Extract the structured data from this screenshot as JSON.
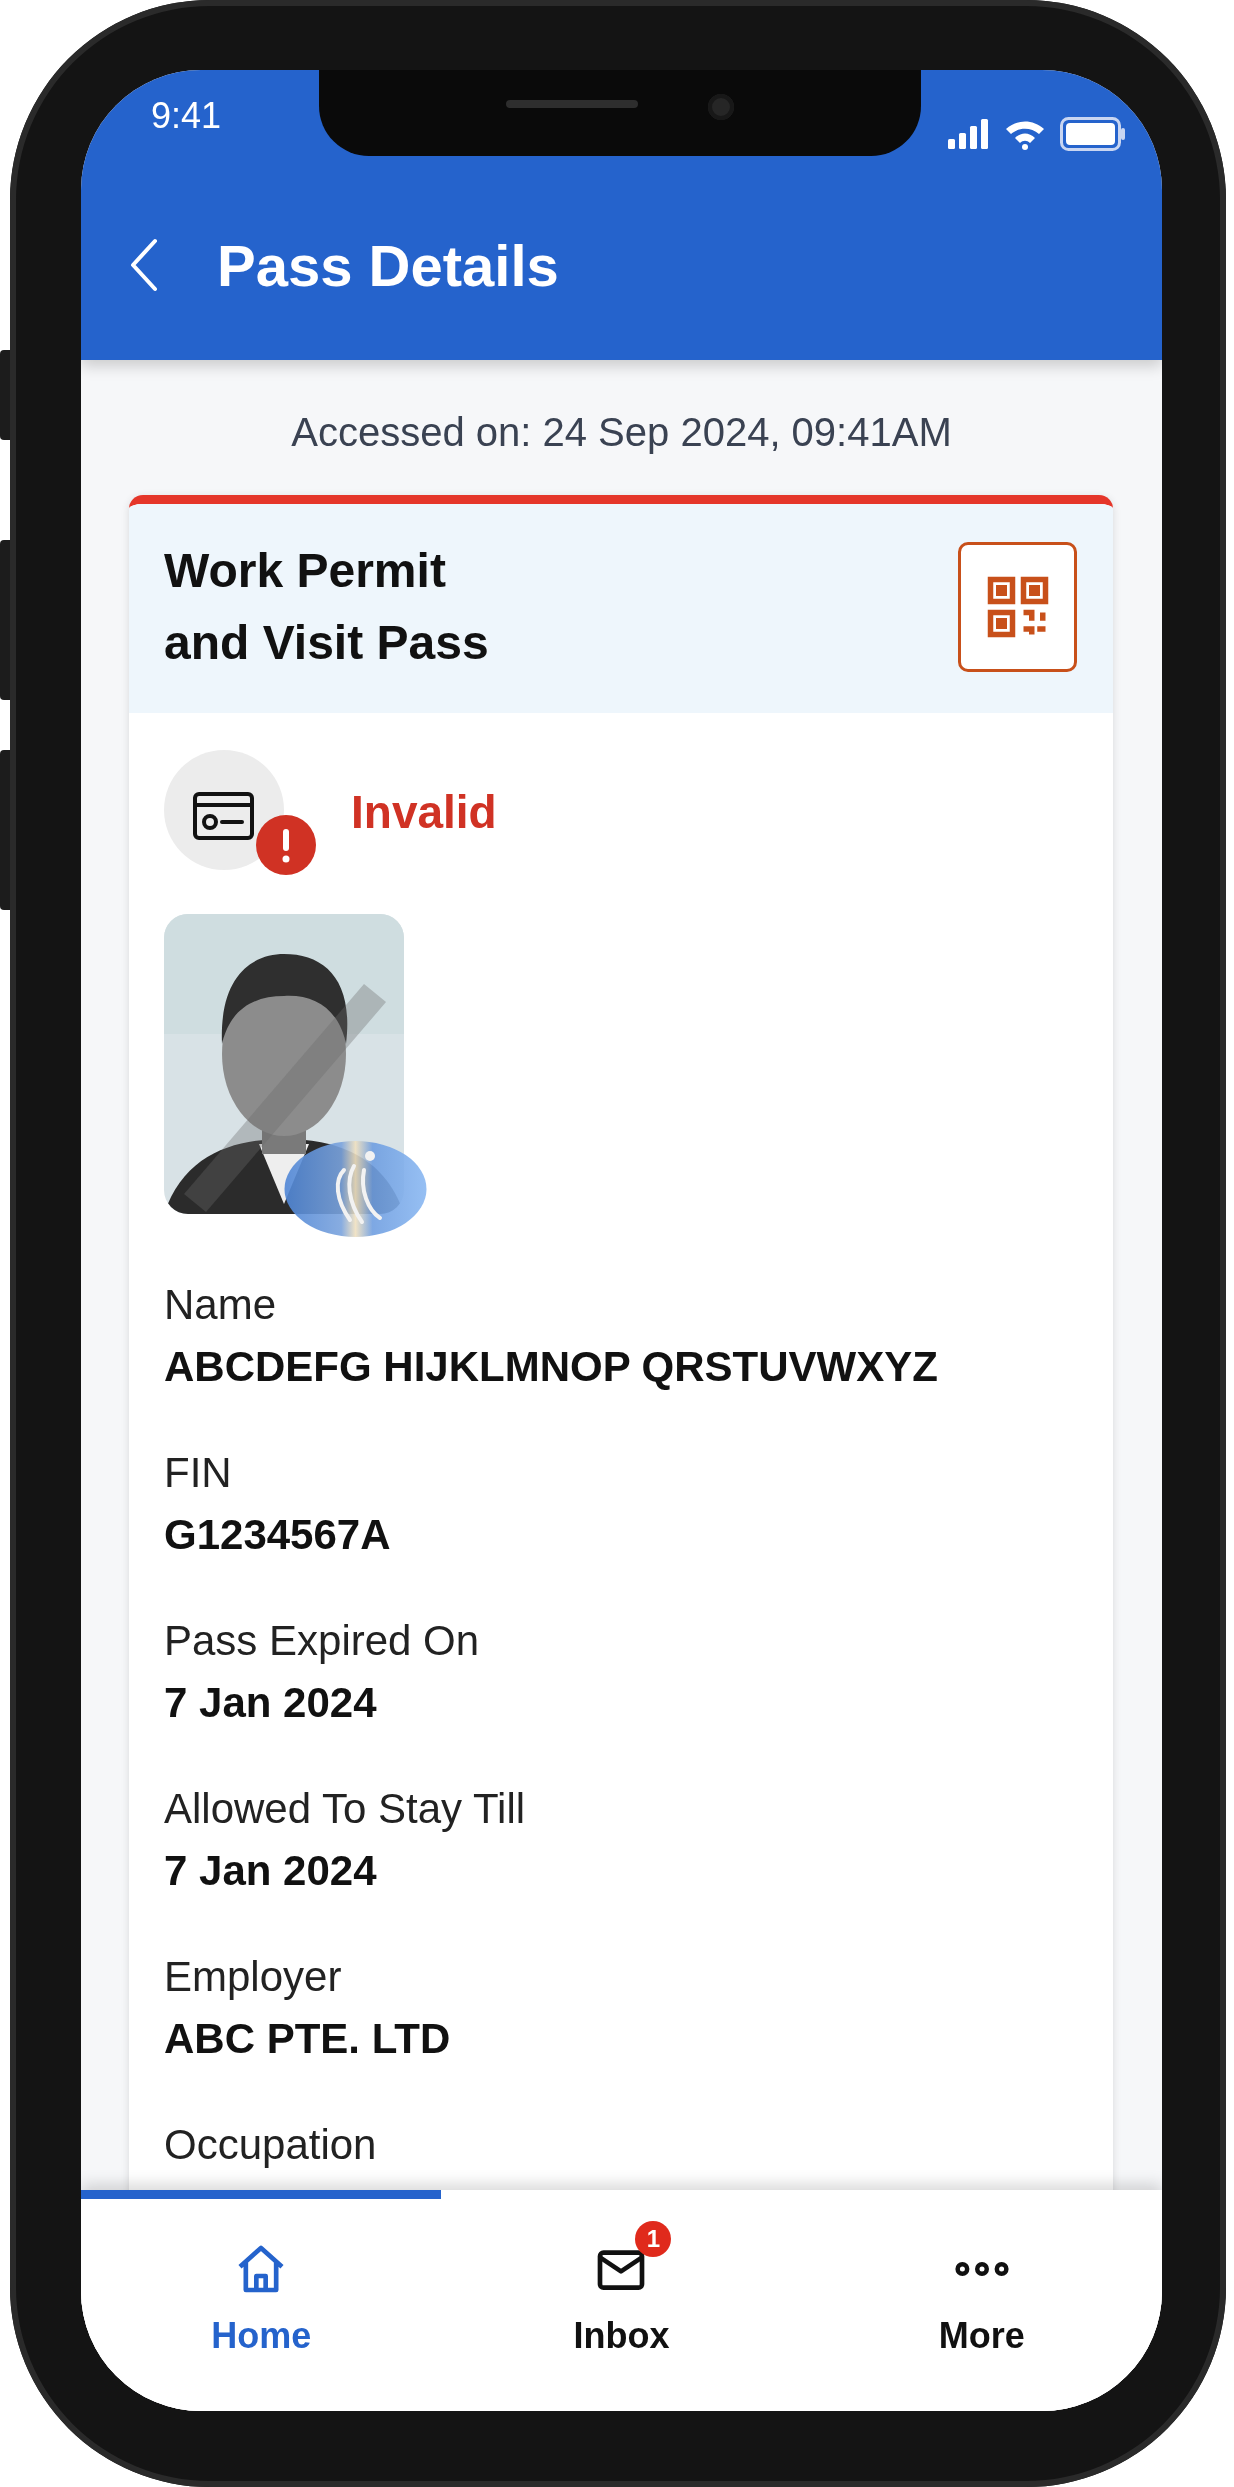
{
  "status_bar": {
    "time": "9:41"
  },
  "header": {
    "title": "Pass Details"
  },
  "accessed": "Accessed on: 24 Sep 2024, 09:41AM",
  "card": {
    "title_lines": [
      "Work Permit",
      "and Visit Pass"
    ],
    "status": {
      "label": "Invalid",
      "kind": "invalid"
    },
    "photo": {
      "kind": "picture"
    },
    "fields": [
      {
        "label": "Name",
        "value": "ABCDEFG HIJKLMNOP QRSTUVWXYZ"
      },
      {
        "label": "FIN",
        "value": "G1234567A"
      },
      {
        "label": "Pass Expired On",
        "value": "7 Jan 2024"
      },
      {
        "label": "Allowed To Stay Till",
        "value": "7 Jan 2024"
      },
      {
        "label": "Employer",
        "value": "ABC PTE. LTD"
      },
      {
        "label": "Occupation"
      }
    ]
  },
  "nav": {
    "items": [
      {
        "label": "Home",
        "kind": "home",
        "selected": true
      },
      {
        "label": "Inbox",
        "kind": "inbox",
        "badge": "1",
        "selected": false
      },
      {
        "label": "More",
        "kind": "more",
        "selected": false
      }
    ]
  }
}
